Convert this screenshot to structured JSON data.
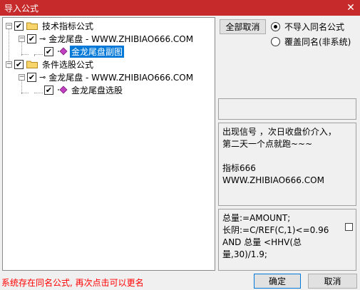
{
  "window": {
    "title": "导入公式",
    "close_glyph": "✕"
  },
  "tree": {
    "groups": [
      {
        "label": "技术指标公式",
        "checked": "✔",
        "expander": "−",
        "children": [
          {
            "label": "金龙尾盘 - WWW.ZHIBIAO666.COM",
            "checked": "✔",
            "expander": "−",
            "children": [
              {
                "label": "金龙尾盘副图",
                "checked": "✔",
                "selected": true
              }
            ]
          }
        ]
      },
      {
        "label": "条件选股公式",
        "checked": "✔",
        "expander": "−",
        "children": [
          {
            "label": "金龙尾盘 - WWW.ZHIBIAO666.COM",
            "checked": "✔",
            "expander": "−",
            "children": [
              {
                "label": "金龙尾盘选股",
                "checked": "✔",
                "selected": false
              }
            ]
          }
        ]
      }
    ]
  },
  "options": {
    "deselect_all_label": "全部取消",
    "radio_no_import": "不导入同名公式",
    "radio_overwrite": "覆盖同名(非系统)",
    "selected_radio": "no_import"
  },
  "description": {
    "lines": [
      "出现信号 ，次日收盘价介入，",
      "第二天一个点就跑~~~",
      "",
      "指标666",
      "WWW.ZHIBIAO666.COM"
    ]
  },
  "code": {
    "lines": [
      "总量:=AMOUNT;",
      "长阴:=C/REF(C,1)<=0.96",
      "AND 总量 <HHV(总",
      "量,30)/1.9;"
    ]
  },
  "footer": {
    "status": "系统存在同名公式, 再次点击可以更名",
    "ok_label": "确定",
    "cancel_label": "取消"
  },
  "colors": {
    "titlebar": "#c62a2a",
    "selection": "#0078d7",
    "status_text": "#ff0000"
  }
}
